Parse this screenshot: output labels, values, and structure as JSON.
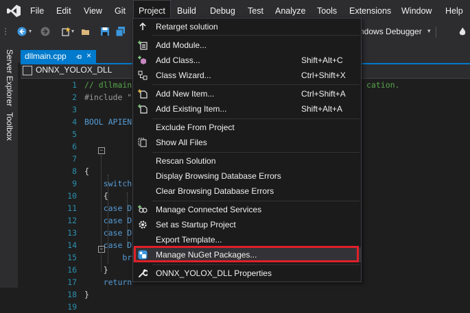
{
  "menu": {
    "items": [
      "File",
      "Edit",
      "View",
      "Git",
      "Project",
      "Build",
      "Debug",
      "Test",
      "Analyze",
      "Tools",
      "Extensions",
      "Window",
      "Help"
    ],
    "active": "Project"
  },
  "toolbar": {
    "debugger_label": "ndows Debugger",
    "dropdown_glyph": "▾"
  },
  "sidebar": {
    "tabs": [
      "Server Explorer",
      "Toolbox"
    ]
  },
  "document": {
    "tab_label": "dllmain.cpp",
    "tab_close": "×",
    "project": "ONNX_YOLOX_DLL"
  },
  "editor": {
    "lines": [
      {
        "n": "1",
        "text": "// dllmain",
        "cls": "c-comment"
      },
      {
        "n": "2",
        "text": "#include \"",
        "cls": "c-pre"
      },
      {
        "n": "3",
        "text": "",
        "cls": "c-plain"
      },
      {
        "n": "4",
        "text": "BOOL APIEN",
        "cls": "c-key"
      },
      {
        "n": "5",
        "text": "",
        "cls": "c-plain"
      },
      {
        "n": "6",
        "text": "",
        "cls": "c-plain"
      },
      {
        "n": "7",
        "text": "",
        "cls": "c-plain"
      },
      {
        "n": "8",
        "text": "{",
        "cls": "c-plain"
      },
      {
        "n": "9",
        "text": "    switch",
        "cls": "c-key"
      },
      {
        "n": "10",
        "text": "    {",
        "cls": "c-plain"
      },
      {
        "n": "11",
        "text": "    case D",
        "cls": "c-key"
      },
      {
        "n": "12",
        "text": "    case D",
        "cls": "c-key"
      },
      {
        "n": "13",
        "text": "    case D",
        "cls": "c-key"
      },
      {
        "n": "14",
        "text": "    case D",
        "cls": "c-key"
      },
      {
        "n": "15",
        "text": "        br",
        "cls": "c-key"
      },
      {
        "n": "16",
        "text": "    }",
        "cls": "c-plain"
      },
      {
        "n": "17",
        "text": "    return",
        "cls": "c-key"
      },
      {
        "n": "18",
        "text": "}",
        "cls": "c-plain"
      },
      {
        "n": "19",
        "text": "",
        "cls": "c-plain"
      }
    ],
    "trailing_comment": "cation."
  },
  "dropdown": {
    "items": [
      {
        "label": "Retarget solution",
        "shortcut": "",
        "icon": "retarget-icon"
      },
      {
        "label": "Add Module...",
        "shortcut": "",
        "icon": "add-module-icon"
      },
      {
        "label": "Add Class...",
        "shortcut": "Shift+Alt+C",
        "icon": "add-class-icon"
      },
      {
        "label": "Class Wizard...",
        "shortcut": "Ctrl+Shift+X",
        "icon": "class-wizard-icon"
      },
      {
        "label": "Add New Item...",
        "shortcut": "Ctrl+Shift+A",
        "icon": "add-new-item-icon"
      },
      {
        "label": "Add Existing Item...",
        "shortcut": "Shift+Alt+A",
        "icon": "add-existing-item-icon"
      },
      {
        "label": "Exclude From Project",
        "shortcut": "",
        "icon": ""
      },
      {
        "label": "Show All Files",
        "shortcut": "",
        "icon": "show-all-files-icon"
      },
      {
        "label": "Rescan Solution",
        "shortcut": "",
        "icon": ""
      },
      {
        "label": "Display Browsing Database Errors",
        "shortcut": "",
        "icon": ""
      },
      {
        "label": "Clear Browsing Database Errors",
        "shortcut": "",
        "icon": ""
      },
      {
        "label": "Manage Connected Services",
        "shortcut": "",
        "icon": "connected-services-icon"
      },
      {
        "label": "Set as Startup Project",
        "shortcut": "",
        "icon": "gear-icon"
      },
      {
        "label": "Export Template...",
        "shortcut": "",
        "icon": ""
      },
      {
        "label": "Manage NuGet Packages...",
        "shortcut": "",
        "icon": "nuget-icon"
      },
      {
        "label": "ONNX_YOLOX_DLL Properties",
        "shortcut": "",
        "icon": "wrench-icon"
      }
    ]
  },
  "colors": {
    "accent": "#007acc",
    "highlight_box": "#e0202a",
    "menu_bg": "#1b1b1c",
    "chrome_bg": "#2d2d30"
  }
}
